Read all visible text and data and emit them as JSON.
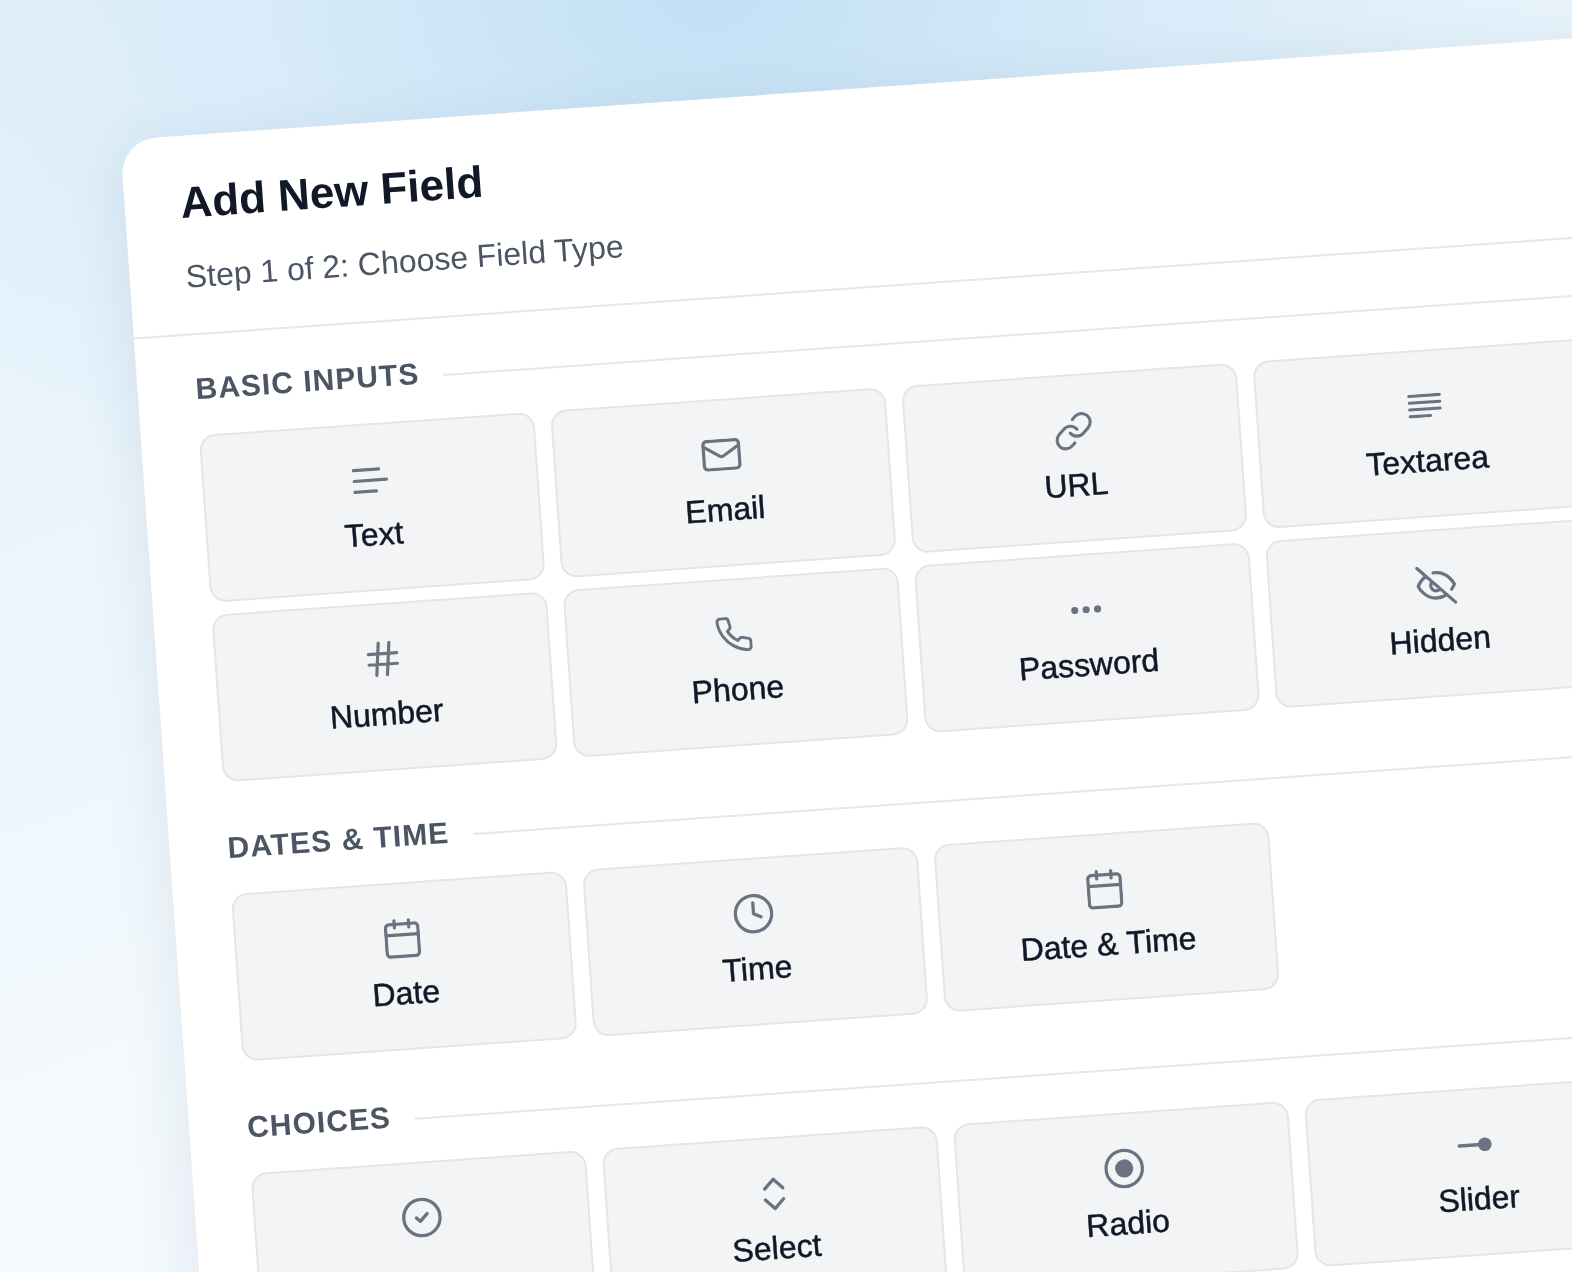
{
  "dialog": {
    "title": "Add New Field",
    "subtitle": "Step 1 of 2: Choose Field Type"
  },
  "sections": [
    {
      "heading": "BASIC INPUTS",
      "field_types": [
        {
          "kind": "text",
          "label": "Text"
        },
        {
          "kind": "email",
          "label": "Email"
        },
        {
          "kind": "url",
          "label": "URL"
        },
        {
          "kind": "textarea",
          "label": "Textarea"
        },
        {
          "kind": "number",
          "label": "Number"
        },
        {
          "kind": "phone",
          "label": "Phone"
        },
        {
          "kind": "password",
          "label": "Password"
        },
        {
          "kind": "hidden",
          "label": "Hidden"
        }
      ]
    },
    {
      "heading": "DATES & TIME",
      "field_types": [
        {
          "kind": "date",
          "label": "Date"
        },
        {
          "kind": "time",
          "label": "Time"
        },
        {
          "kind": "datetime",
          "label": "Date & Time"
        }
      ]
    },
    {
      "heading": "CHOICES",
      "field_types": [
        {
          "kind": "checkbox"
        },
        {
          "kind": "select",
          "label": "Select"
        },
        {
          "kind": "radio",
          "label": "Radio"
        },
        {
          "kind": "slider",
          "label": "Slider"
        }
      ]
    }
  ]
}
